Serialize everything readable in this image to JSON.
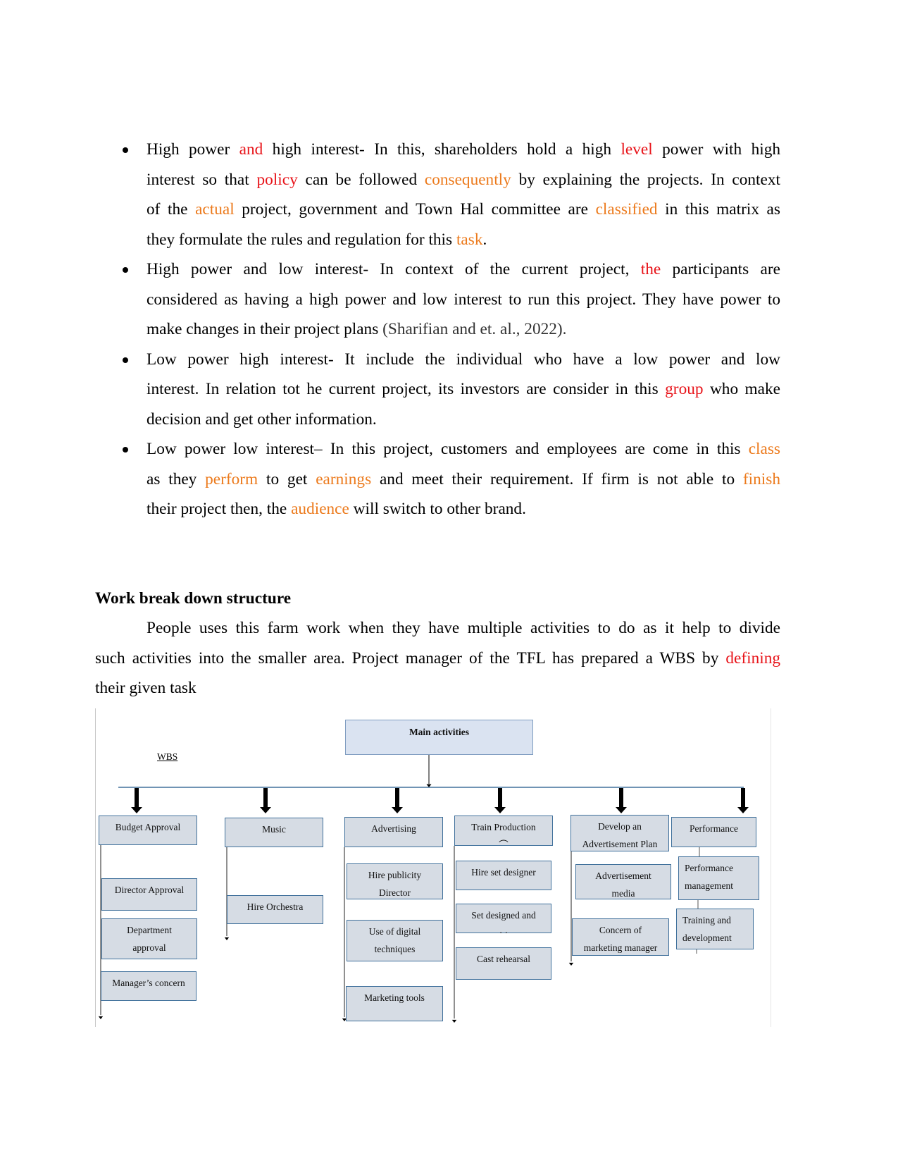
{
  "bullets": [
    {
      "lines": [
        [
          {
            "t": "High power ",
            "s": "b"
          },
          {
            "t": "and",
            "s": "b red"
          },
          {
            "t": " high interest-",
            "s": "b"
          },
          {
            "t": " In this, shareholders hold a high "
          },
          {
            "t": "level",
            "s": "red"
          },
          {
            "t": " power with high"
          }
        ],
        [
          {
            "t": "interest so that "
          },
          {
            "t": "policy",
            "s": "red"
          },
          {
            "t": " can be followed "
          },
          {
            "t": "consequently",
            "s": "orange"
          },
          {
            "t": " by explaining the projects. In context"
          }
        ],
        [
          {
            "t": "of the "
          },
          {
            "t": "actual",
            "s": "orange"
          },
          {
            "t": " project,  government and Town Hal committee are "
          },
          {
            "t": "classified",
            "s": "orange"
          },
          {
            "t": " in this matrix as"
          }
        ],
        [
          {
            "t": "they formulate the rules and regulation for this "
          },
          {
            "t": "task",
            "s": "orange"
          },
          {
            "t": "."
          }
        ]
      ]
    },
    {
      "lines": [
        [
          {
            "t": "High power and low interest",
            "s": "b"
          },
          {
            "t": "- In context of the current project, "
          },
          {
            "t": "the",
            "s": "red"
          },
          {
            "t": " participants are"
          }
        ],
        [
          {
            "t": "considered as having a high power and low interest to run this project. They have power to"
          }
        ],
        [
          {
            "t": "make changes in their project plans "
          },
          {
            "t": "(Sharifian and et. al., 2022).",
            "s": "gray"
          }
        ]
      ]
    },
    {
      "lines": [
        [
          {
            "t": "Low power high interest",
            "s": "b"
          },
          {
            "t": "- It include the individual who have a low power and low"
          }
        ],
        [
          {
            "t": "interest. In relation tot he current project, its investors are consider in this "
          },
          {
            "t": "group",
            "s": "red"
          },
          {
            "t": " who make"
          }
        ],
        [
          {
            "t": "decision and get other information."
          }
        ]
      ]
    },
    {
      "lines": [
        [
          {
            "t": "Low power low interest–",
            "s": "b"
          },
          {
            "t": " In this project, customers and employees are come in this "
          },
          {
            "t": "class",
            "s": "orange"
          }
        ],
        [
          {
            "t": "as they "
          },
          {
            "t": "perform",
            "s": "orange"
          },
          {
            "t": " to get "
          },
          {
            "t": "earnings",
            "s": "orange"
          },
          {
            "t": " and meet their requirement. If firm is not able to "
          },
          {
            "t": "finish",
            "s": "orange"
          }
        ],
        [
          {
            "t": "their project then, the "
          },
          {
            "t": "audience",
            "s": "orange"
          },
          {
            "t": " will switch to other brand."
          }
        ]
      ]
    }
  ],
  "section": {
    "heading": "Work break down structure",
    "paragraph_lines": [
      [
        {
          "t": "People uses this farm work when they have multiple activities to do as it help to divide"
        }
      ],
      [
        {
          "t": "such activities into the smaller area. Project manager of the TFL has prepared a WBS by "
        },
        {
          "t": "defining",
          "s": "red"
        }
      ],
      [
        {
          "t": "their given task"
        }
      ]
    ]
  },
  "wbs": {
    "label": "WBS",
    "root": "Main activities",
    "branches": [
      {
        "title": [
          "Budget Approval"
        ],
        "children": [
          [
            "Director Approval"
          ],
          [
            "Department",
            "approval"
          ],
          [
            "Manager’s concern"
          ]
        ]
      },
      {
        "title": [
          "Music"
        ],
        "children": [
          [
            "Hire Orchestra"
          ]
        ]
      },
      {
        "title": [
          "Advertising"
        ],
        "children": [
          [
            "Hire publicity",
            "Director"
          ],
          [
            "Use of digital",
            "techniques"
          ],
          [
            "Marketing tools"
          ]
        ]
      },
      {
        "title": [
          "Train Production",
          "⌒"
        ],
        "children": [
          [
            "Hire set designer"
          ],
          [
            "Set designed and",
            "· ·"
          ],
          [
            "Cast rehearsal"
          ]
        ]
      },
      {
        "title": [
          "Develop an",
          "Advertisement Plan"
        ],
        "children": [
          [
            "Advertisement",
            "media"
          ],
          [
            "Concern of",
            "marketing manager"
          ]
        ]
      },
      {
        "title": [
          "Performance"
        ],
        "children": [
          [
            "Performance",
            "management"
          ],
          [
            "Training and",
            "development"
          ]
        ]
      }
    ]
  },
  "colors": {
    "red": "#e8141a",
    "orange": "#ec7a1c",
    "box_fill": "#d6dce4",
    "box_border": "#41719c",
    "root_fill": "#dae3f1"
  }
}
